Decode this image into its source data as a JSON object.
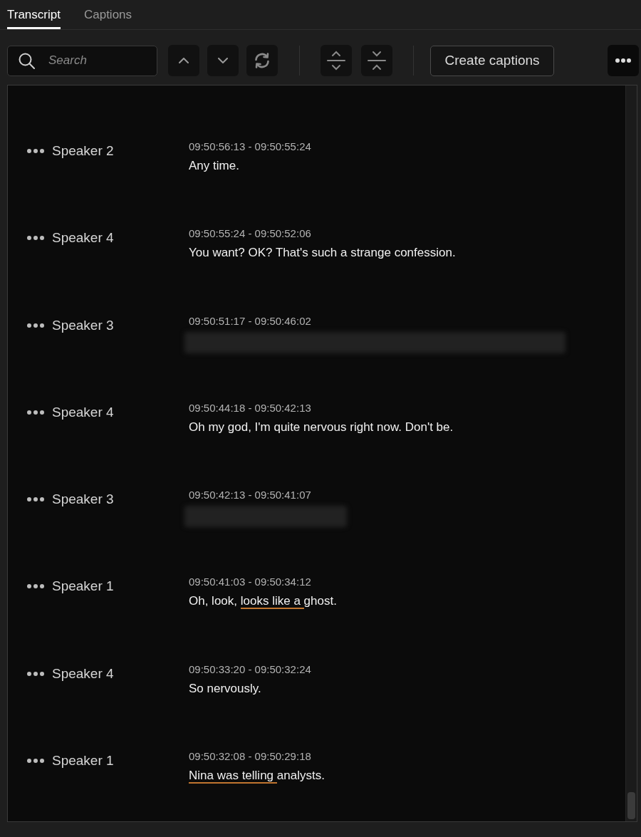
{
  "tabs": [
    {
      "label": "Transcript",
      "selected": true
    },
    {
      "label": "Captions",
      "selected": false
    }
  ],
  "toolbar": {
    "search": {
      "placeholder": "Search"
    },
    "create_button": "Create captions"
  },
  "segments": [
    {
      "speaker": "Speaker 2",
      "time": "09:50:56:13 - 09:50:55:24",
      "blurred": false,
      "parts": [
        {
          "text": "Any time.",
          "underlined": false
        }
      ]
    },
    {
      "speaker": "Speaker 4",
      "time": "09:50:55:24 - 09:50:52:06",
      "blurred": false,
      "parts": [
        {
          "text": "You want? OK? That's such a strange confession.",
          "underlined": false
        }
      ]
    },
    {
      "speaker": "Speaker 3",
      "time": "09:50:51:17 - 09:50:46:02",
      "blurred": true
    },
    {
      "speaker": "Speaker 4",
      "time": "09:50:44:18 - 09:50:42:13",
      "blurred": false,
      "parts": [
        {
          "text": "Oh my god, I'm quite nervous right now. Don't be.",
          "underlined": false
        }
      ]
    },
    {
      "speaker": "Speaker 3",
      "time": "09:50:42:13 - 09:50:41:07",
      "blurred": true
    },
    {
      "speaker": "Speaker 1",
      "time": "09:50:41:03 - 09:50:34:12",
      "blurred": false,
      "parts": [
        {
          "text": "Oh, look, ",
          "underlined": false
        },
        {
          "text": "looks like a ",
          "underlined": true
        },
        {
          "text": "ghost.",
          "underlined": false
        }
      ]
    },
    {
      "speaker": "Speaker 4",
      "time": "09:50:33:20 - 09:50:32:24",
      "blurred": false,
      "parts": [
        {
          "text": "So nervously.",
          "underlined": false
        }
      ]
    },
    {
      "speaker": "Speaker 1",
      "time": "09:50:32:08 - 09:50:29:18",
      "blurred": false,
      "parts": [
        {
          "text": "Nina was telling ",
          "underlined": true
        },
        {
          "text": "analysts.",
          "underlined": false
        }
      ]
    }
  ]
}
